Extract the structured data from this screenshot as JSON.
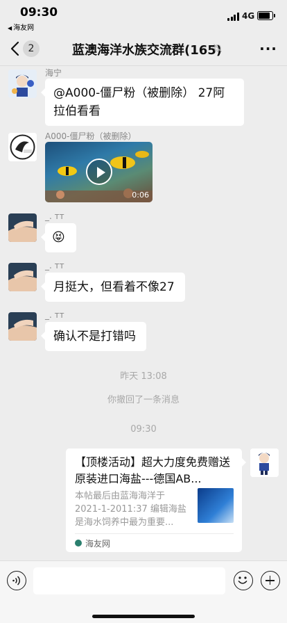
{
  "status_bar": {
    "time": "09:30",
    "back_app": "海友网",
    "network": "4G"
  },
  "nav": {
    "unread_count": "2",
    "title": "蓝澳海洋水族交流群(165)",
    "back_icon": "chevron-left-icon",
    "mute_icon": "bell-muted-icon",
    "more_icon": "more-dots-icon"
  },
  "messages": [
    {
      "sender": "海宁",
      "text": "@A000-僵尸粉（被删除） 27阿拉伯看看"
    },
    {
      "sender": "A000-僵尸粉（被删除）",
      "video_duration": "0:06"
    },
    {
      "sender": "_. ᴛᴛ",
      "text": "😝"
    },
    {
      "sender": "_. ᴛᴛ",
      "text": "月挺大，但看着不像27"
    },
    {
      "sender": "_. ᴛᴛ",
      "text": "确认不是打错吗"
    }
  ],
  "timestamps": {
    "t1": "昨天 13:08",
    "recall_notice": "你撤回了一条消息",
    "t2": "09:30"
  },
  "link_card": {
    "title": "【顶楼活动】超大力度免费赠送原装进口海盐---德国AB...",
    "description": "本帖最后由蓝海海洋于 2021-1-2011:37 编辑海盐是海水饲养中最为重要...",
    "source": "海友网"
  },
  "input_bar": {
    "voice_icon": "voice-icon",
    "emoji_icon": "emoji-icon",
    "plus_icon": "plus-icon"
  }
}
